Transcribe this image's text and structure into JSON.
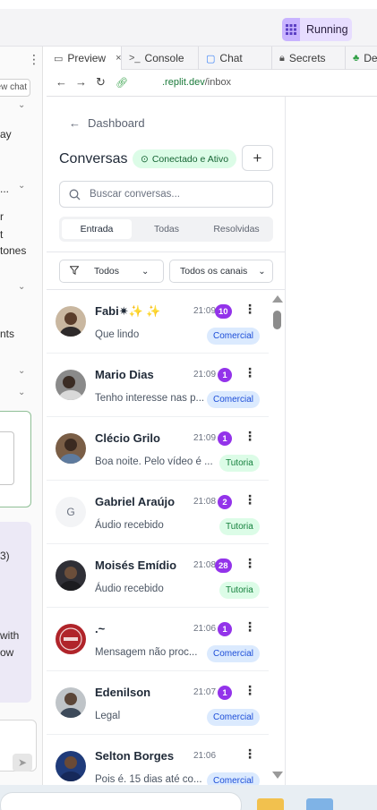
{
  "topbar": {
    "running_label": "Running"
  },
  "left_panel": {
    "new_chat_label": "ew chat",
    "lines": [
      "ay",
      "...",
      "r",
      "t",
      "tones",
      "nts",
      "3)",
      "with",
      "ow"
    ]
  },
  "tabs": [
    {
      "label": "Preview",
      "icon": "monitor-icon"
    },
    {
      "label": "Console",
      "icon": "terminal-icon"
    },
    {
      "label": "Chat",
      "icon": "chat-icon"
    },
    {
      "label": "Secrets",
      "icon": "lock-icon"
    },
    {
      "label": "De",
      "icon": "tree-icon"
    }
  ],
  "urlbar": {
    "domain": ".replit.dev",
    "path": "/inbox"
  },
  "app": {
    "back_label": "Dashboard",
    "title": "Conversas",
    "status": "Conectado e Ativo",
    "search_placeholder": "Buscar conversas...",
    "segments": [
      "Entrada",
      "Todas",
      "Resolvidas"
    ],
    "filter_status": "Todos",
    "filter_channel": "Todos os canais"
  },
  "conversations": [
    {
      "name": "Fabi✷✨ ✨",
      "time": "21:09",
      "unread": "10",
      "preview": "Que lindo",
      "tag": "Comercial"
    },
    {
      "name": "Mario Dias",
      "time": "21:09",
      "unread": "1",
      "preview": "Tenho interesse nas p...",
      "tag": "Comercial"
    },
    {
      "name": "Clécio Grilo",
      "time": "21:09",
      "unread": "1",
      "preview": "Boa noite. Pelo vídeo é ...",
      "tag": "Tutoria"
    },
    {
      "name": "Gabriel Araújo",
      "time": "21:08",
      "unread": "2",
      "preview": "Áudio recebido",
      "tag": "Tutoria",
      "avatar_letter": "G"
    },
    {
      "name": "Moisés Emídio",
      "time": "21:08",
      "unread": "28",
      "preview": "Áudio recebido",
      "tag": "Tutoria"
    },
    {
      "name": ".~",
      "time": "21:06",
      "unread": "1",
      "preview": "Mensagem não proc...",
      "tag": "Comercial"
    },
    {
      "name": "Edenilson",
      "time": "21:07",
      "unread": "1",
      "preview": "Legal",
      "tag": "Comercial"
    },
    {
      "name": "Selton Borges",
      "time": "21:06",
      "unread": "",
      "preview": "Pois é. 15 dias até co...",
      "tag": "Comercial"
    }
  ],
  "colors": {
    "accent_purple": "#9333ea",
    "tag_comercial_bg": "#dbeafe",
    "tag_tutoria_bg": "#dcfce7",
    "status_bg": "#dcfce7"
  }
}
